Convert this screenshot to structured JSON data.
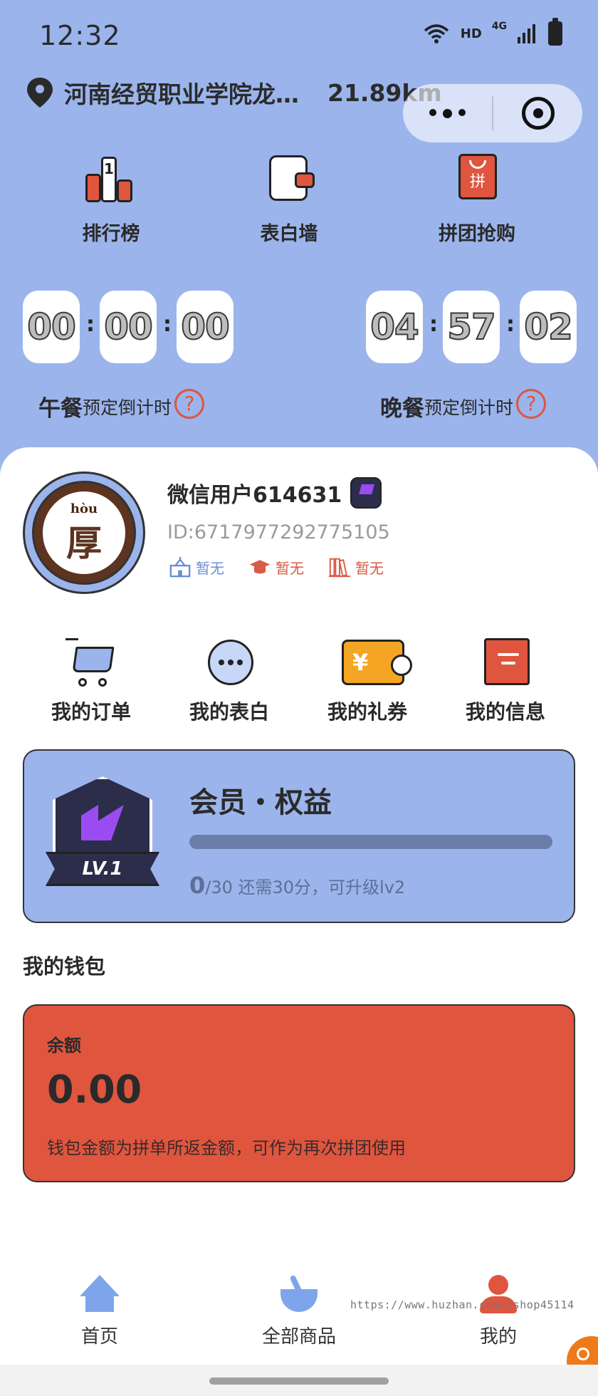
{
  "status_bar": {
    "time": "12:32",
    "hd": "HD",
    "network": "4G"
  },
  "location": {
    "name": "河南经贸职业学院龙…",
    "distance": "21.89km",
    "icon": "location-pin-icon"
  },
  "quick_nav": [
    {
      "label": "排行榜",
      "icon": "ranking-icon",
      "rank_num": "1"
    },
    {
      "label": "表白墙",
      "icon": "confession-wall-icon"
    },
    {
      "label": "拼团抢购",
      "icon": "group-buy-icon",
      "glyph": "拼"
    }
  ],
  "countdowns": {
    "lunch": {
      "hh": "00",
      "mm": "00",
      "ss": "00",
      "meal": "午餐",
      "caption": "预定倒计时"
    },
    "dinner": {
      "hh": "04",
      "mm": "57",
      "ss": "02",
      "meal": "晚餐",
      "caption": "预定倒计时"
    },
    "help": "?"
  },
  "user": {
    "name": "微信用户614631",
    "id": "ID:6717977292775105",
    "avatar_pinyin": "hòu",
    "avatar_char": "厚",
    "tags": [
      {
        "icon": "school-icon",
        "text": "暂无"
      },
      {
        "icon": "graduation-cap-icon",
        "text": "暂无"
      },
      {
        "icon": "books-icon",
        "text": "暂无"
      }
    ]
  },
  "actions": [
    {
      "label": "我的订单",
      "icon": "cart-icon"
    },
    {
      "label": "我的表白",
      "icon": "chat-bubble-icon"
    },
    {
      "label": "我的礼券",
      "icon": "coupon-icon",
      "glyph": "¥"
    },
    {
      "label": "我的信息",
      "icon": "message-icon"
    }
  ],
  "membership": {
    "title": "会员・权益",
    "level": "LV.1",
    "points_current": "0",
    "points_rest": "/30 还需30分，可升级lv2",
    "progress": 0
  },
  "wallet": {
    "title": "我的钱包",
    "label": "余额",
    "amount": "0.00",
    "note": "钱包金额为拼单所返金额，可作为再次拼团使用"
  },
  "tabbar": [
    {
      "label": "首页",
      "icon": "home-icon"
    },
    {
      "label": "全部商品",
      "icon": "bowl-icon"
    },
    {
      "label": "我的",
      "icon": "user-icon"
    }
  ],
  "watermark": "https://www.huzhan.com/ishop45114",
  "colors": {
    "primary_blue": "#9bb4ec",
    "accent_red": "#e0553e",
    "coupon_orange": "#f5a524",
    "badge_purple": "#9b4cf0"
  }
}
